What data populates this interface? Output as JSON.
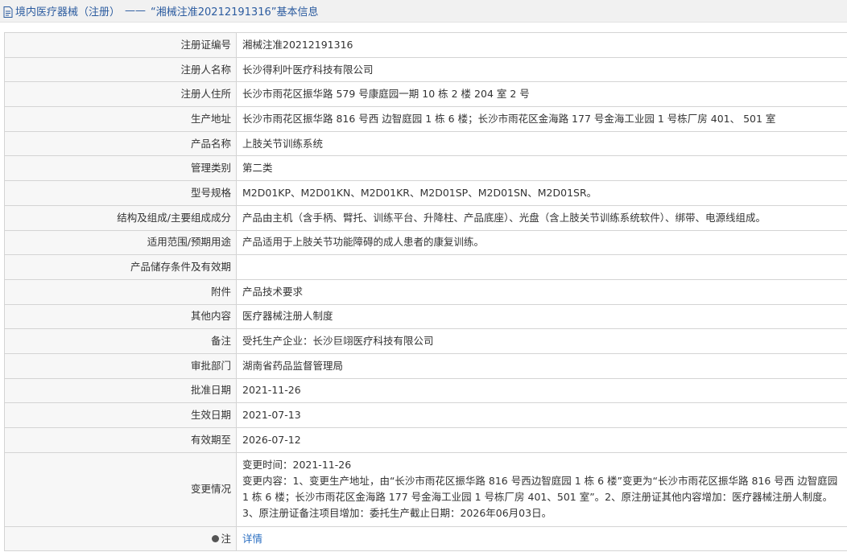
{
  "header": {
    "category": "境内医疗器械（注册）",
    "separator": "——",
    "title": "“湘械注准20212191316”基本信息"
  },
  "rows": [
    {
      "label": "注册证编号",
      "value": "湘械注准20212191316"
    },
    {
      "label": "注册人名称",
      "value": "长沙得利叶医疗科技有限公司"
    },
    {
      "label": "注册人住所",
      "value": "长沙市雨花区振华路 579 号康庭园一期 10 栋 2 楼 204 室 2 号"
    },
    {
      "label": "生产地址",
      "value": "长沙市雨花区振华路 816 号西 边智庭园 1 栋 6 楼；长沙市雨花区金海路 177 号金海工业园 1 号栋厂房 401、 501 室"
    },
    {
      "label": "产品名称",
      "value": "上肢关节训练系统"
    },
    {
      "label": "管理类别",
      "value": "第二类"
    },
    {
      "label": "型号规格",
      "value": "M2D01KP、M2D01KN、M2D01KR、M2D01SP、M2D01SN、M2D01SR。"
    },
    {
      "label": "结构及组成/主要组成成分",
      "value": "产品由主机（含手柄、臂托、训练平台、升降柱、产品底座）、光盘（含上肢关节训练系统软件）、绑带、电源线组成。"
    },
    {
      "label": "适用范围/预期用途",
      "value": "产品适用于上肢关节功能障碍的成人患者的康复训练。"
    },
    {
      "label": "产品储存条件及有效期",
      "value": ""
    },
    {
      "label": "附件",
      "value": "产品技术要求"
    },
    {
      "label": "其他内容",
      "value": "医疗器械注册人制度"
    },
    {
      "label": "备注",
      "value": "受托生产企业：长沙巨翊医疗科技有限公司"
    },
    {
      "label": "审批部门",
      "value": "湖南省药品监督管理局"
    },
    {
      "label": "批准日期",
      "value": "2021-11-26"
    },
    {
      "label": "生效日期",
      "value": "2021-07-13"
    },
    {
      "label": "有效期至",
      "value": "2026-07-12"
    }
  ],
  "change": {
    "label": "变更情况",
    "time": "变更时间：2021-11-26",
    "content": "变更内容：1、变更生产地址，由“长沙市雨花区振华路 816 号西边智庭园 1 栋 6 楼”变更为“长沙市雨花区振华路 816 号西 边智庭园 1 栋 6 楼；长沙市雨花区金海路 177 号金海工业园 1 号栋厂房 401、501 室”。2、原注册证其他内容增加：医疗器械注册人制度。3、原注册证备注项目增加：委托生产截止日期：2026年06月03日。"
  },
  "note": {
    "label": "注",
    "link": "详情"
  },
  "colors": {
    "header_text": "#2b5b9f",
    "link": "#2b6fc2",
    "label_bg": "#f7f7f7",
    "border": "#d4d4d4"
  },
  "icons": {
    "header": "document-icon",
    "note": "bulb-icon"
  }
}
